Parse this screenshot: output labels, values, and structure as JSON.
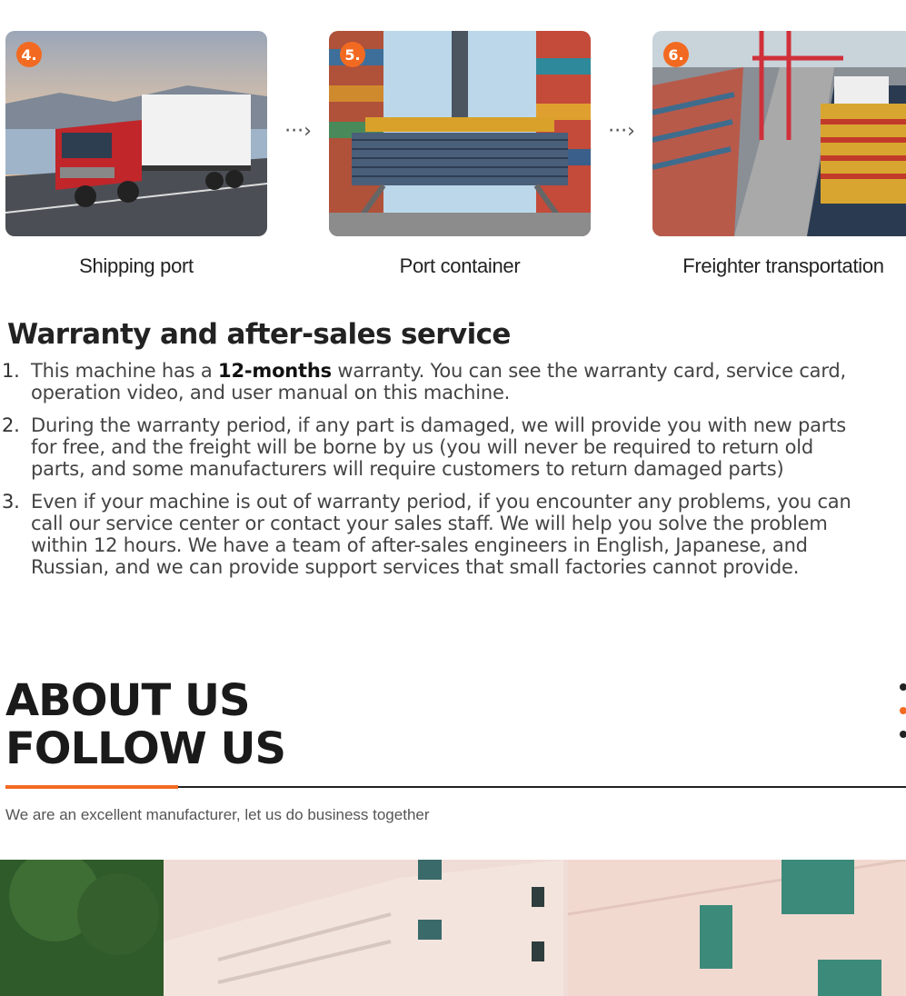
{
  "steps": [
    {
      "num": "4.",
      "caption": "Shipping port",
      "image": "truck-photo"
    },
    {
      "num": "5.",
      "caption": "Port container",
      "image": "container-crane-photo"
    },
    {
      "num": "6.",
      "caption": "Freighter transportation",
      "image": "cargo-ship-photo"
    }
  ],
  "arrow_glyph": "···›",
  "warranty": {
    "title": "Warranty and after-sales service",
    "items": [
      {
        "num": "1.",
        "lines": [
          "This machine has a ",
          "12-months",
          " warranty. You can see the warranty card, service card,",
          "operation video, and user manual on this machine."
        ]
      },
      {
        "num": "2.",
        "lines": [
          "During the warranty period, if any part is damaged, we will provide you with new parts",
          "for free, and the freight will be borne by us (you will never be required to return old",
          "parts, and some manufacturers will require customers to return damaged parts)"
        ]
      },
      {
        "num": "3.",
        "lines": [
          "Even if your machine is out of warranty period, if you encounter any problems, you can",
          "call our service center or contact your sales staff. We will help you solve the problem",
          "within 12 hours. We have a team of after-sales engineers in English, Japanese, and",
          "Russian, and we can provide support services that small factories cannot provide."
        ]
      }
    ]
  },
  "about": {
    "heading_line1": "ABOUT US",
    "heading_line2": "FOLLOW US",
    "tagline": "We are an excellent manufacturer, let us do business together"
  },
  "colors": {
    "accent": "#f26a21",
    "text": "#222222"
  }
}
